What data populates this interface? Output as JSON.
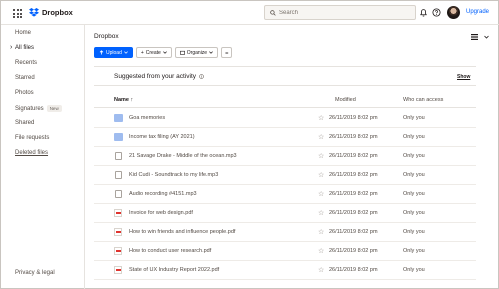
{
  "brand": {
    "name": "Dropbox"
  },
  "search": {
    "placeholder": "Search"
  },
  "topbar": {
    "upgrade_label": "Upgrade"
  },
  "sidebar": {
    "items": [
      {
        "label": "Home"
      },
      {
        "label": "All files",
        "active": true
      },
      {
        "label": "Recents"
      },
      {
        "label": "Starred"
      },
      {
        "label": "Photos"
      },
      {
        "label": "Signatures",
        "badge": "New"
      },
      {
        "label": "Shared"
      },
      {
        "label": "File requests"
      },
      {
        "label": "Deleted files"
      }
    ],
    "footer_label": "Privacy & legal"
  },
  "main": {
    "title": "Dropbox",
    "toolbar": {
      "upload_label": "Upload",
      "create_label": "Create",
      "organize_label": "Organize",
      "more_label": "•••"
    },
    "suggested": {
      "title": "Suggested from your activity",
      "show_label": "Show"
    },
    "table": {
      "headers": {
        "name": "Name ↑",
        "modified": "Modified",
        "access": "Who can access"
      },
      "rows": [
        {
          "name": "Goa memories",
          "type": "folder",
          "modified": "26/11/2019 8:02 pm",
          "access": "Only you"
        },
        {
          "name": "Income tax filing (AY 2021)",
          "type": "folder",
          "modified": "26/11/2019 8:02 pm",
          "access": "Only you"
        },
        {
          "name": "21 Savage Drake - Middle of the ocean.mp3",
          "type": "audio",
          "modified": "26/11/2019 8:02 pm",
          "access": "Only you"
        },
        {
          "name": "Kid Cudi - Soundtrack to my life.mp3",
          "type": "audio",
          "modified": "26/11/2019 8:02 pm",
          "access": "Only you"
        },
        {
          "name": "Audio recording #4151.mp3",
          "type": "audio",
          "modified": "26/11/2019 8:02 pm",
          "access": "Only you"
        },
        {
          "name": "Invoice for web design.pdf",
          "type": "pdf",
          "modified": "26/11/2019 8:02 pm",
          "access": "Only you"
        },
        {
          "name": "How to win friends and influence people.pdf",
          "type": "pdf",
          "modified": "26/11/2019 8:02 pm",
          "access": "Only you"
        },
        {
          "name": "How to conduct user research.pdf",
          "type": "pdf",
          "modified": "26/11/2019 8:02 pm",
          "access": "Only you"
        },
        {
          "name": "State of UX Industry Report 2022.pdf",
          "type": "pdf",
          "modified": "26/11/2019 8:02 pm",
          "access": "Only you"
        }
      ]
    }
  },
  "colors": {
    "accent": "#0061fe",
    "folder": "#9fbcef",
    "pdf": "#e0342f"
  }
}
